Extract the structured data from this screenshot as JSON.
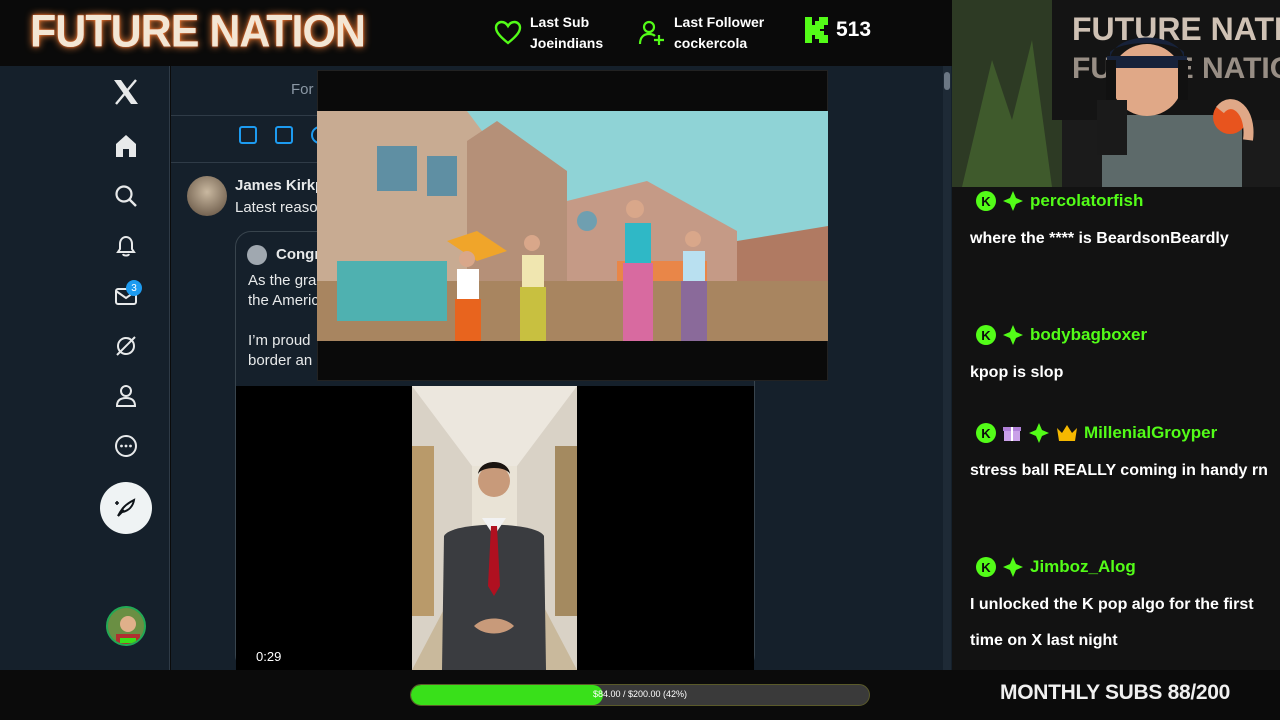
{
  "brand": "FUTURE NATION",
  "stats": {
    "last_sub_label": "Last Sub",
    "last_sub_name": "Joeindians",
    "last_follower_label": "Last Follower",
    "last_follower_name": "cockercola",
    "kick_viewers": "513"
  },
  "x_app": {
    "nav_icons": [
      "x-logo-icon",
      "home-icon",
      "search-icon",
      "notifications-icon",
      "messages-icon",
      "grok-icon",
      "profile-icon",
      "more-icon"
    ],
    "messages_badge": "3",
    "tab_label": "For",
    "tweet": {
      "name": "James Kirkp",
      "text": "Latest reaso"
    },
    "quote": {
      "name": "Congr",
      "lines": [
        "As the gra",
        "the Americ",
        "I’m proud",
        "border an"
      ]
    },
    "video_time": "0:29"
  },
  "chat": [
    {
      "user": "percolatorfish",
      "message": "where the **** is BeardsonBeardly"
    },
    {
      "user": "bodybagboxer",
      "message": "kpop is slop"
    },
    {
      "user": "MillenialGroyper",
      "message": "stress ball REALLY coming in handy rn"
    },
    {
      "user": "Jimboz_Alog",
      "message": "I unlocked the K pop algo for the first time on X last night"
    }
  ],
  "goal": {
    "text": "$84.00 / $200.00 (42%)",
    "fraction": 0.42
  },
  "monthly_subs": "MONTHLY SUBS 88/200",
  "colors": {
    "kick_green": "#53fc18",
    "x_bg": "#15202b",
    "x_blue": "#1d9bf0"
  }
}
